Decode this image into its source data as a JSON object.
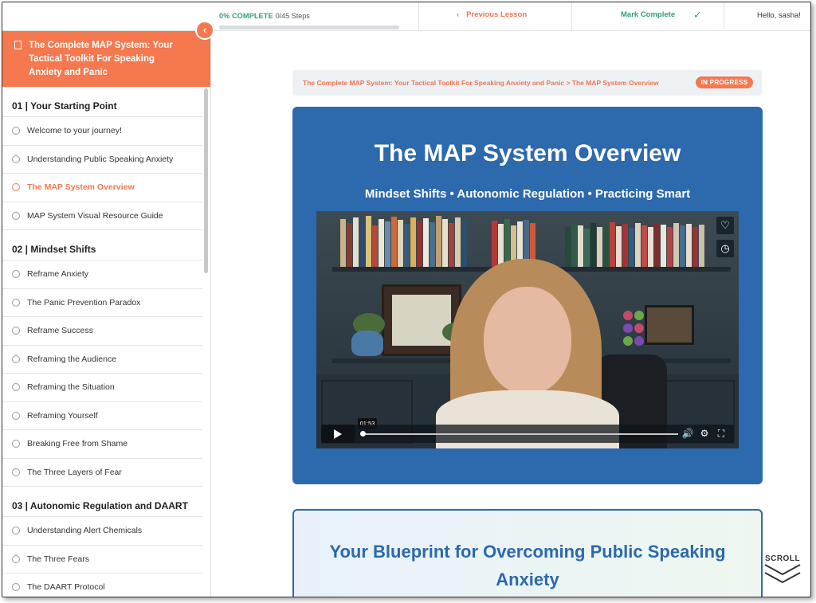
{
  "topbar": {
    "progress_percent_label": "0% COMPLETE",
    "progress_steps": "0/45 Steps",
    "progress_fraction": 0.0,
    "previous_lesson": "Previous Lesson",
    "mark_complete": "Mark Complete",
    "greeting": "Hello, sasha!"
  },
  "course": {
    "title": "The Complete MAP System: Your Tactical Toolkit For Speaking Anxiety and Panic"
  },
  "sidebar": {
    "sections": [
      {
        "title": "01 | Your Starting Point",
        "items": [
          "Welcome to your journey!",
          "Understanding Public Speaking Anxiety",
          "The MAP System Overview",
          "MAP System Visual Resource Guide"
        ]
      },
      {
        "title": "02 | Mindset Shifts",
        "items": [
          "Reframe Anxiety",
          "The Panic Prevention Paradox",
          "Reframe Success",
          "Reframing the Audience",
          "Reframing the Situation",
          "Reframing Yourself",
          "Breaking Free from Shame",
          "The Three Layers of Fear"
        ]
      },
      {
        "title": "03 | Autonomic Regulation and DAART",
        "items": [
          "Understanding Alert Chemicals",
          "The Three Fears",
          "The DAART Protocol"
        ]
      }
    ],
    "active_item": "The MAP System Overview"
  },
  "main": {
    "breadcrumb": "The Complete MAP System: Your Tactical Toolkit For Speaking Anxiety and Panic > The MAP System Overview",
    "status": "IN PROGRESS",
    "hero_title": "The MAP System Overview",
    "hero_subtitle": "Mindset Shifts • Autonomic Regulation • Practicing Smart",
    "video": {
      "time_tooltip": "01:53",
      "icons": [
        "heart-icon",
        "clock-icon",
        "play-icon",
        "volume-icon",
        "settings-icon",
        "fullscreen-icon"
      ]
    },
    "blueprint_title": "Your Blueprint for Overcoming Public Speaking Anxiety"
  },
  "scroll_hint": "SCROLL",
  "colors": {
    "accent_orange": "#f5784f",
    "brand_blue": "#2c69ad",
    "success_green": "#2e9e7a"
  }
}
